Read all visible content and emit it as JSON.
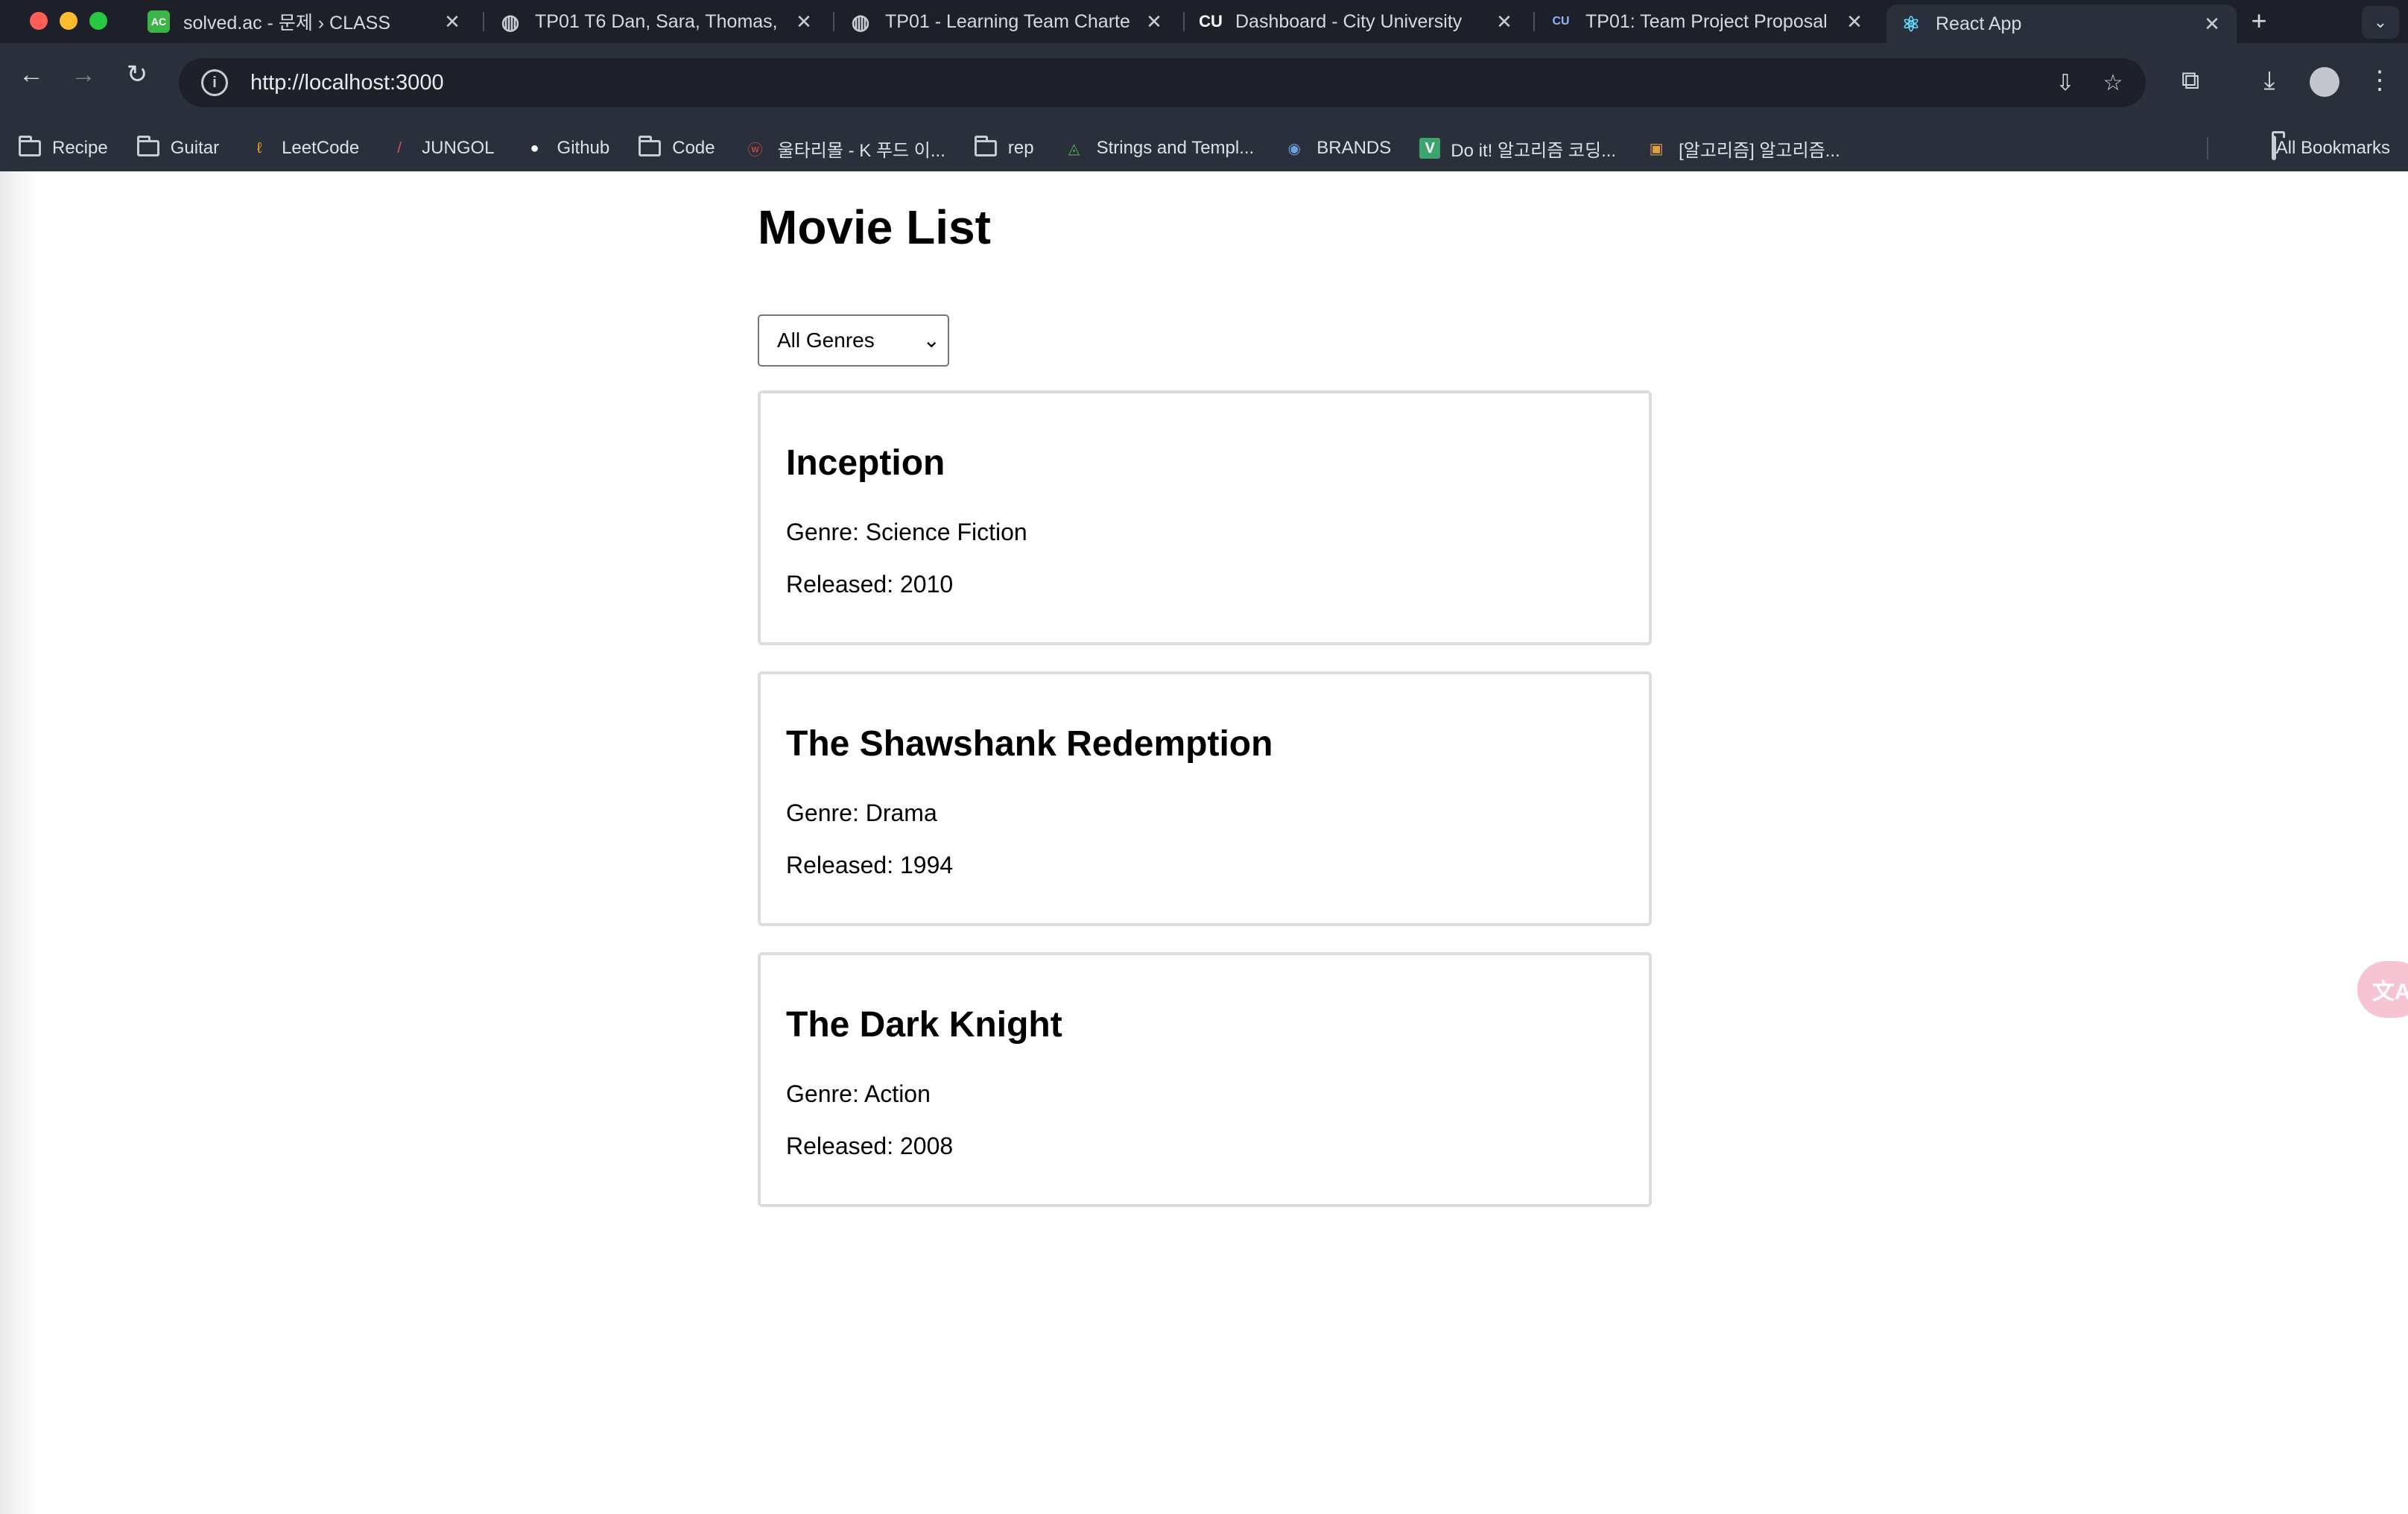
{
  "browser": {
    "tabs": [
      {
        "title": "solved.ac - 문제 › CLASS",
        "favicon": "AC",
        "favicon_color": "#3cb44a"
      },
      {
        "title": "TP01 T6 Dan, Sara, Thomas,",
        "favicon": "◍",
        "favicon_color": "#3a3f4b"
      },
      {
        "title": "TP01 - Learning Team Charte",
        "favicon": "◍",
        "favicon_color": "#3a3f4b"
      },
      {
        "title": "Dashboard - City University",
        "favicon": "CU",
        "favicon_color": "#1d2029"
      },
      {
        "title": "TP01: Team Project Proposal",
        "favicon": "CU",
        "favicon_color": "#1d2029"
      },
      {
        "title": "React App",
        "favicon": "⚛",
        "favicon_color": "#1d2029"
      }
    ],
    "url": "http://localhost:3000",
    "bookmarks": [
      {
        "label": "Recipe",
        "icon": "folder-icon"
      },
      {
        "label": "Guitar",
        "icon": "folder-icon"
      },
      {
        "label": "LeetCode",
        "icon": "leetcode-icon"
      },
      {
        "label": "JUNGOL",
        "icon": "jungol-icon"
      },
      {
        "label": "Github",
        "icon": "github-icon"
      },
      {
        "label": "Code",
        "icon": "folder-icon"
      },
      {
        "label": "울타리몰 - K 푸드 이...",
        "icon": "shop-icon"
      },
      {
        "label": "rep",
        "icon": "folder-icon"
      },
      {
        "label": "Strings and Templ...",
        "icon": "site-icon"
      },
      {
        "label": "BRANDS",
        "icon": "brands-icon"
      },
      {
        "label": "Do it! 알고리즘 코딩...",
        "icon": "v-icon"
      },
      {
        "label": "[알고리즘] 알고리즘...",
        "icon": "book-icon"
      }
    ],
    "all_bookmarks_label": "All Bookmarks"
  },
  "page": {
    "title": "Movie List",
    "genre_filter": {
      "selected": "All Genres"
    },
    "movies": [
      {
        "title": "Inception",
        "genre_label": "Genre: Science Fiction",
        "released_label": "Released: 2010"
      },
      {
        "title": "The Shawshank Redemption",
        "genre_label": "Genre: Drama",
        "released_label": "Released: 1994"
      },
      {
        "title": "The Dark Knight",
        "genre_label": "Genre: Action",
        "released_label": "Released: 2008"
      }
    ],
    "translate_widget": "文A"
  }
}
